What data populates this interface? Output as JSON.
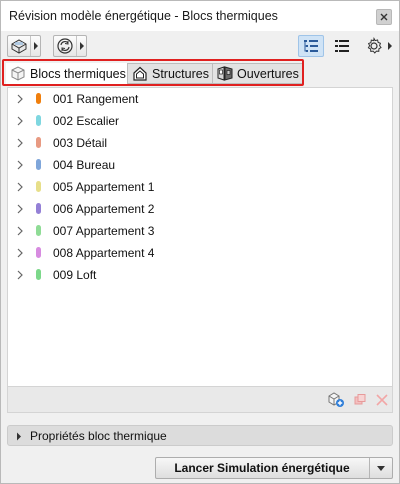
{
  "window": {
    "title": "Révision modèle énergétique - Blocs thermiques"
  },
  "toolbar": {
    "left_buttons": [
      {
        "icon": "model-view-icon"
      },
      {
        "icon": "refresh-cycle-icon"
      }
    ],
    "view_modes": [
      {
        "icon": "tree-list-icon",
        "active": true
      },
      {
        "icon": "flat-list-icon",
        "active": false
      }
    ],
    "settings_icon": "gear-icon"
  },
  "tabs": [
    {
      "label": "Blocs thermiques",
      "icon": "thermal-block-icon",
      "selected": true
    },
    {
      "label": "Structures",
      "icon": "structure-house-icon",
      "selected": false
    },
    {
      "label": "Ouvertures",
      "icon": "openings-icon",
      "selected": false
    }
  ],
  "zones": [
    {
      "label": "001 Rangement",
      "color": "#f07f0d"
    },
    {
      "label": "002 Escalier",
      "color": "#7fd7e0"
    },
    {
      "label": "003 Détail",
      "color": "#e89a82"
    },
    {
      "label": "004 Bureau",
      "color": "#7fa6da"
    },
    {
      "label": "005 Appartement 1",
      "color": "#e7df8a"
    },
    {
      "label": "006 Appartement 2",
      "color": "#9480d6"
    },
    {
      "label": "007 Appartement 3",
      "color": "#8fdc96"
    },
    {
      "label": "008 Appartement 4",
      "color": "#d78be0"
    },
    {
      "label": "009 Loft",
      "color": "#7cd88a"
    }
  ],
  "list_actions": [
    {
      "icon": "add-zone-icon",
      "enabled": true
    },
    {
      "icon": "duplicate-zone-icon",
      "enabled": false
    },
    {
      "icon": "delete-zone-icon",
      "enabled": false
    }
  ],
  "properties_panel": {
    "label": "Propriétés bloc thermique"
  },
  "launch": {
    "label": "Lancer Simulation énergétique"
  },
  "colors": {
    "highlight_frame": "#e0201f",
    "active_view_bg": "#cfe3f6"
  }
}
